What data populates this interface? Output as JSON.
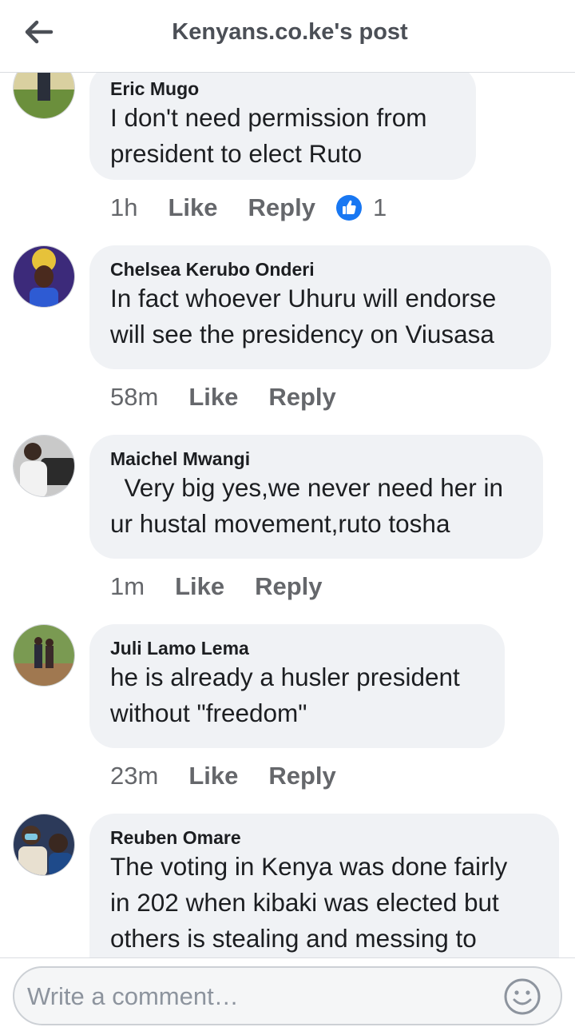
{
  "header": {
    "title": "Kenyans.co.ke's post"
  },
  "comments": [
    {
      "author": "Eric Mugo",
      "text": "I don't need permission from\npresident to elect Ruto",
      "time": "1h",
      "like": "Like",
      "reply": "Reply",
      "reaction_count": "1"
    },
    {
      "author": "Chelsea Kerubo Onderi",
      "text": "In fact whoever Uhuru will endorse\nwill see the presidency on Viusasa",
      "time": "58m",
      "like": "Like",
      "reply": "Reply"
    },
    {
      "author": "Maichel Mwangi",
      "text": "  Very big yes,we never need her in\nur hustal movement,ruto tosha",
      "time": "1m",
      "like": "Like",
      "reply": "Reply"
    },
    {
      "author": "Juli Lamo Lema",
      "text": "he is already a husler president\nwithout \"freedom\"",
      "time": "23m",
      "like": "Like",
      "reply": "Reply"
    },
    {
      "author": "Reuben Omare",
      "text": "The voting in Kenya was done fairly\nin 202 when kibaki was elected but\nothers is stealing and messing to"
    }
  ],
  "composer": {
    "placeholder": "Write a comment…"
  },
  "colors": {
    "like_badge": "#1877f2",
    "bubble": "#f0f2f5",
    "muted_text": "#65676b"
  },
  "icons": {
    "back": "back-arrow-icon",
    "like": "like-thumb-icon",
    "emoji": "emoji-icon"
  }
}
